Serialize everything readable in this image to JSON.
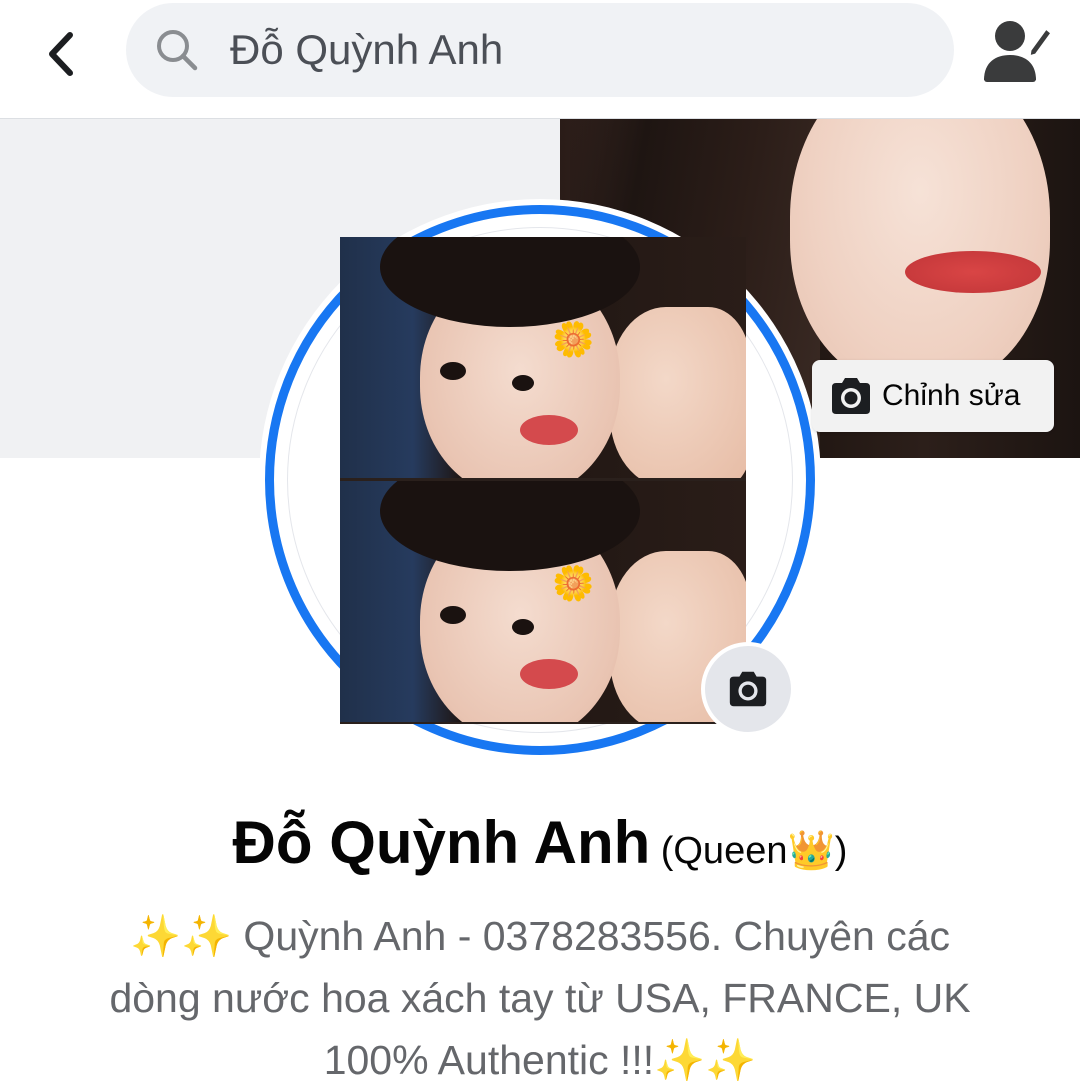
{
  "search": {
    "query": "Đỗ Quỳnh Anh"
  },
  "cover": {
    "edit_label": "Chỉnh sửa"
  },
  "profile": {
    "name": "Đỗ Quỳnh Anh",
    "alternate_name": "(Queen👑)",
    "bio": "✨✨ Quỳnh Anh - 0378283556. Chuyên các\ndòng nước hoa xách tay từ USA, FRANCE, UK\n100% Authentic !!!✨✨"
  },
  "icons": {
    "back": "chevron-left-icon",
    "search": "search-icon",
    "profile_edit": "person-pencil-icon",
    "camera": "camera-icon",
    "flower": "🌼"
  },
  "colors": {
    "accent": "#1877f2",
    "search_bg": "#f0f2f5",
    "bio_text": "#65676b"
  }
}
